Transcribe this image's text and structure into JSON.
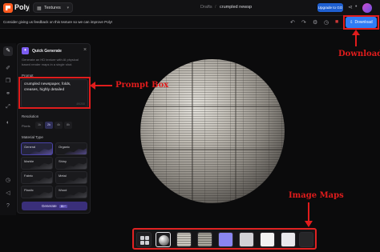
{
  "topbar": {
    "brand": "Poly",
    "texture_pill": "Textures",
    "drafts": "Drafts",
    "separator": "/",
    "doc_name": "crumpled newsp",
    "upgrade_label": "Upgrade to GO"
  },
  "banner": {
    "text": "Consider giving us feedback on this texture so we can improve Poly!",
    "download_label": "Download"
  },
  "panel": {
    "title": "Quick Generate",
    "description": "Generate an HD texture with AI physical based render maps in a single shot.",
    "prompt_label": "Prompt",
    "prompt_value": "crumpled newspaper, folds, creases, highly detailed",
    "prompt_counter": "49/200",
    "resolution_label": "Resolution",
    "resolution_row_label": "Pixels",
    "resolutions": [
      "1k",
      "2k",
      "4k",
      "8k"
    ],
    "material_type_label": "Material Type",
    "materials": [
      "General",
      "Organic",
      "Marble",
      "Shiny",
      "Fabric",
      "Metal",
      "Plastic",
      "Wood"
    ],
    "generate_label": "Generate",
    "generate_kbd": "⌘↵"
  },
  "annotations": {
    "prompt_box": "Prompt Box",
    "download": "Download",
    "image_maps": "Image Maps"
  },
  "colors": {
    "accent_blue": "#2f7cf6",
    "annotation_red": "#e01c1c",
    "material_purple": "#7b5cf0"
  }
}
